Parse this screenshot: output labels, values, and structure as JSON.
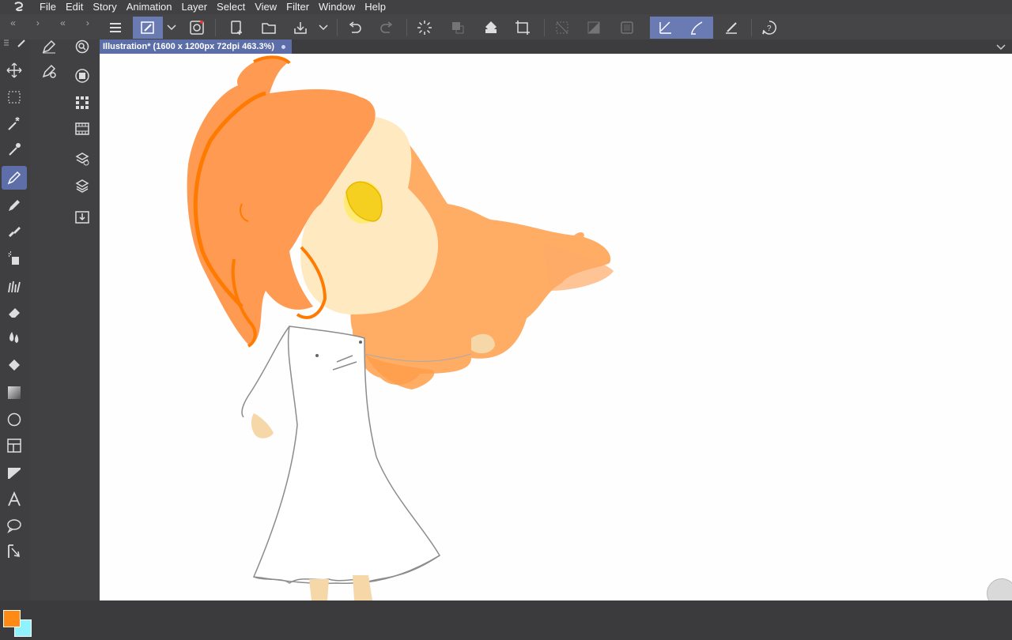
{
  "menu": {
    "items": [
      "File",
      "Edit",
      "Story",
      "Animation",
      "Layer",
      "Select",
      "View",
      "Filter",
      "Window",
      "Help"
    ]
  },
  "collapse_controls": [
    "«",
    "›",
    "«",
    "›"
  ],
  "document_tab": {
    "title": "Illustration* (1600 x 1200px 72dpi 463.3%)"
  },
  "toolbar_icons": [
    "menu-icon",
    "pen-pressure-icon",
    "chevron-down-icon",
    "spiral-icon",
    "new-canvas-icon",
    "open-icon",
    "save-icon",
    "chevron-down-icon",
    "undo-icon",
    "redo-icon",
    "loading-icon",
    "transform-icon",
    "fill-icon",
    "crop-icon",
    "invert-icon",
    "layer-icon",
    "frame-icon",
    "stabilize-icon",
    "brush-tip-icon",
    "vector-icon",
    "help-icon"
  ],
  "colors": {
    "main_color": "#ff8a16",
    "sub_color": "#8ff2ff",
    "accent": "#5b6ea8"
  }
}
